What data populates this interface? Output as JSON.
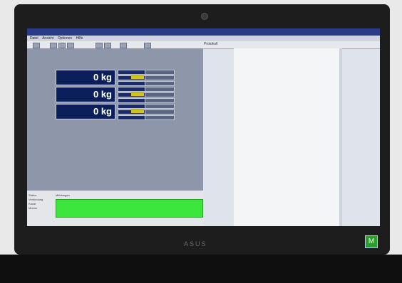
{
  "device": {
    "brand": "ASUS",
    "sticker": "M"
  },
  "app": {
    "menu": [
      "Datei",
      "Ansicht",
      "Optionen",
      "Hilfe"
    ],
    "toolbar_title": "Protokoll"
  },
  "scales": [
    {
      "weight": "0 kg"
    },
    {
      "weight": "0 kg"
    },
    {
      "weight": "0 kg"
    }
  ],
  "status": {
    "labels": [
      "Status",
      "Verbindung",
      "Kanal",
      "Modus"
    ],
    "heading": "Meldungen"
  },
  "log": {
    "text": ""
  },
  "colors": {
    "window_title": "#2a3c86",
    "display_bg": "#0b1f5c",
    "ok_green": "#3de63d"
  }
}
